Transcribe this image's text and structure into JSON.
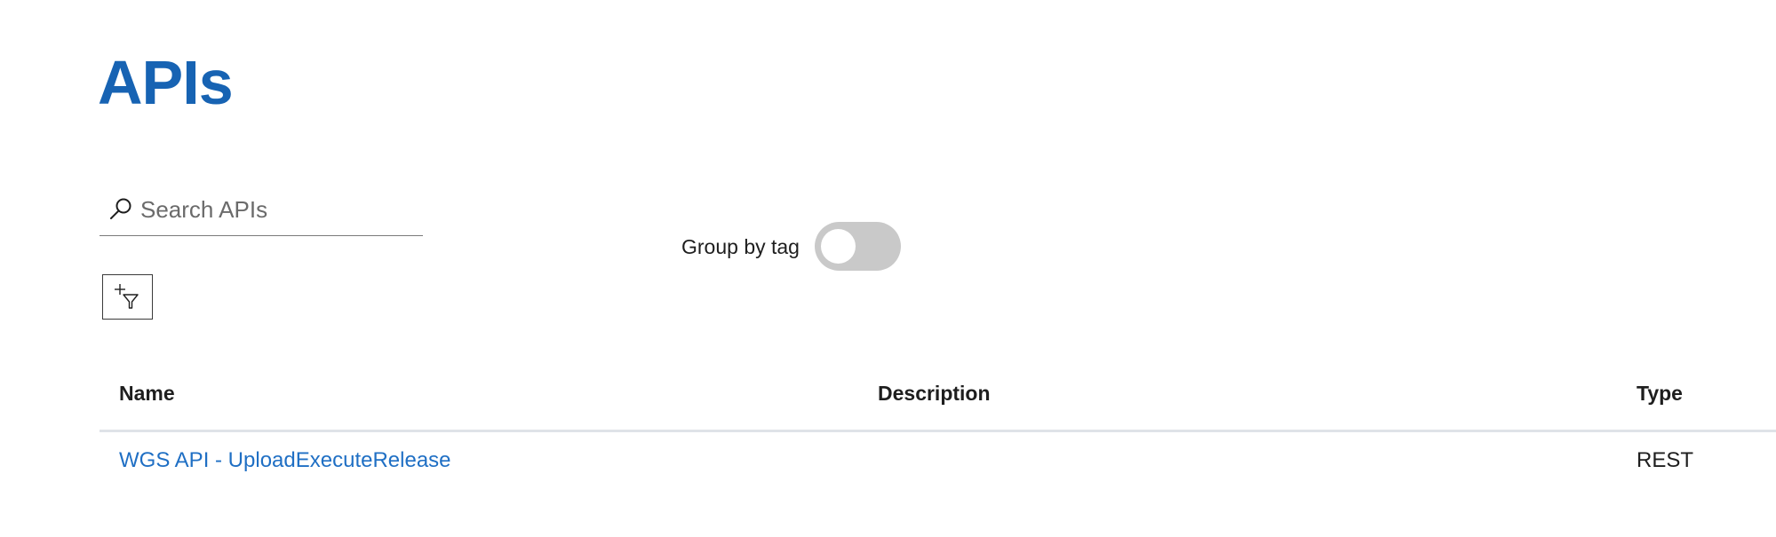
{
  "page": {
    "title": "APIs"
  },
  "search": {
    "placeholder": "Search APIs",
    "value": ""
  },
  "group_by_tag": {
    "label": "Group by tag",
    "enabled": false
  },
  "filter": {
    "icon": "add-filter-icon"
  },
  "table": {
    "columns": [
      "Name",
      "Description",
      "Type"
    ],
    "rows": [
      {
        "name": "WGS API - UploadExecuteRelease",
        "description": "",
        "type": "REST"
      }
    ]
  },
  "colors": {
    "accent": "#1763b3",
    "link": "#1f6fc4",
    "toggle_off": "#c9c9c9"
  }
}
